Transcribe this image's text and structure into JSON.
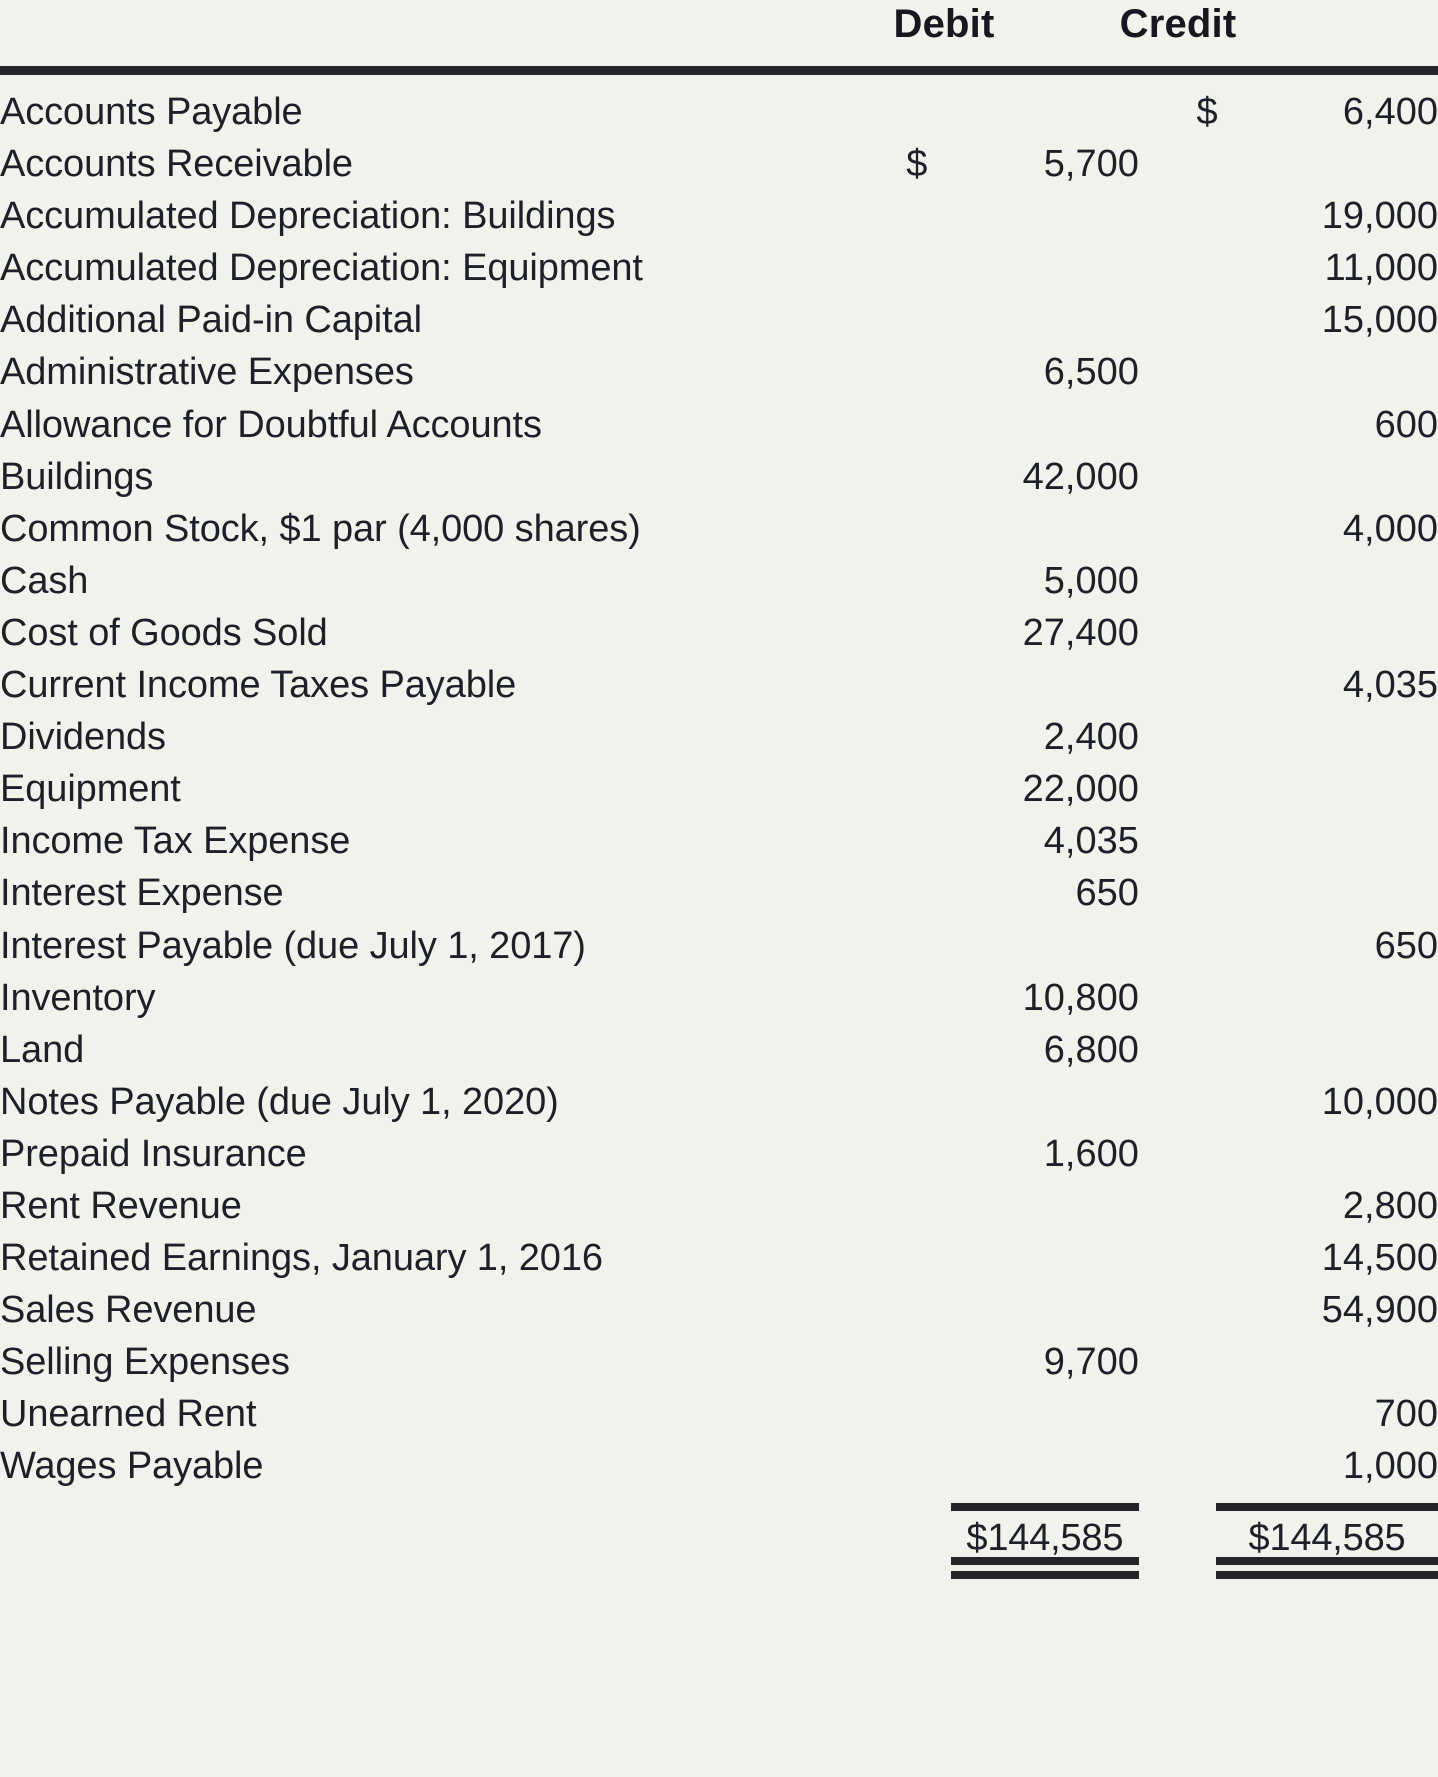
{
  "colors": {
    "background": "#f2f2ec",
    "text": "#1e2029",
    "rule": "#262229"
  },
  "table": {
    "columns": {
      "account_header": "",
      "debit_header": "Debit",
      "credit_header": "Credit"
    },
    "rows": [
      {
        "account": "Accounts Payable",
        "debit_symbol": "",
        "debit": "",
        "credit_symbol": "$",
        "credit": "6,400"
      },
      {
        "account": "Accounts Receivable",
        "debit_symbol": "$",
        "debit": "5,700",
        "credit_symbol": "",
        "credit": ""
      },
      {
        "account": "Accumulated Depreciation: Buildings",
        "debit_symbol": "",
        "debit": "",
        "credit_symbol": "",
        "credit": "19,000"
      },
      {
        "account": "Accumulated Depreciation: Equipment",
        "debit_symbol": "",
        "debit": "",
        "credit_symbol": "",
        "credit": "11,000"
      },
      {
        "account": "Additional Paid-in Capital",
        "debit_symbol": "",
        "debit": "",
        "credit_symbol": "",
        "credit": "15,000"
      },
      {
        "account": "Administrative Expenses",
        "debit_symbol": "",
        "debit": "6,500",
        "credit_symbol": "",
        "credit": ""
      },
      {
        "account": "Allowance for Doubtful Accounts",
        "debit_symbol": "",
        "debit": "",
        "credit_symbol": "",
        "credit": "600"
      },
      {
        "account": "Buildings",
        "debit_symbol": "",
        "debit": "42,000",
        "credit_symbol": "",
        "credit": ""
      },
      {
        "account": "Common Stock, $1 par (4,000 shares)",
        "debit_symbol": "",
        "debit": "",
        "credit_symbol": "",
        "credit": "4,000"
      },
      {
        "account": "Cash",
        "debit_symbol": "",
        "debit": "5,000",
        "credit_symbol": "",
        "credit": ""
      },
      {
        "account": "Cost of Goods Sold",
        "debit_symbol": "",
        "debit": "27,400",
        "credit_symbol": "",
        "credit": ""
      },
      {
        "account": "Current Income Taxes Payable",
        "debit_symbol": "",
        "debit": "",
        "credit_symbol": "",
        "credit": "4,035"
      },
      {
        "account": "Dividends",
        "debit_symbol": "",
        "debit": "2,400",
        "credit_symbol": "",
        "credit": ""
      },
      {
        "account": "Equipment",
        "debit_symbol": "",
        "debit": "22,000",
        "credit_symbol": "",
        "credit": ""
      },
      {
        "account": "Income Tax Expense",
        "debit_symbol": "",
        "debit": "4,035",
        "credit_symbol": "",
        "credit": ""
      },
      {
        "account": "Interest Expense",
        "debit_symbol": "",
        "debit": "650",
        "credit_symbol": "",
        "credit": ""
      },
      {
        "account": "Interest Payable (due July 1, 2017)",
        "debit_symbol": "",
        "debit": "",
        "credit_symbol": "",
        "credit": "650"
      },
      {
        "account": "Inventory",
        "debit_symbol": "",
        "debit": "10,800",
        "credit_symbol": "",
        "credit": ""
      },
      {
        "account": "Land",
        "debit_symbol": "",
        "debit": "6,800",
        "credit_symbol": "",
        "credit": ""
      },
      {
        "account": "Notes Payable (due July 1, 2020)",
        "debit_symbol": "",
        "debit": "",
        "credit_symbol": "",
        "credit": "10,000"
      },
      {
        "account": "Prepaid Insurance",
        "debit_symbol": "",
        "debit": "1,600",
        "credit_symbol": "",
        "credit": ""
      },
      {
        "account": "Rent Revenue",
        "debit_symbol": "",
        "debit": "",
        "credit_symbol": "",
        "credit": "2,800"
      },
      {
        "account": "Retained Earnings, January 1, 2016",
        "debit_symbol": "",
        "debit": "",
        "credit_symbol": "",
        "credit": "14,500"
      },
      {
        "account": "Sales Revenue",
        "debit_symbol": "",
        "debit": "",
        "credit_symbol": "",
        "credit": "54,900"
      },
      {
        "account": "Selling Expenses",
        "debit_symbol": "",
        "debit": "9,700",
        "credit_symbol": "",
        "credit": ""
      },
      {
        "account": "Unearned Rent",
        "debit_symbol": "",
        "debit": "",
        "credit_symbol": "",
        "credit": "700"
      },
      {
        "account": "Wages Payable",
        "debit_symbol": "",
        "debit": "",
        "credit_symbol": "",
        "credit": "1,000"
      }
    ],
    "totals": {
      "label": "",
      "debit": "$144,585",
      "credit": "$144,585"
    }
  }
}
